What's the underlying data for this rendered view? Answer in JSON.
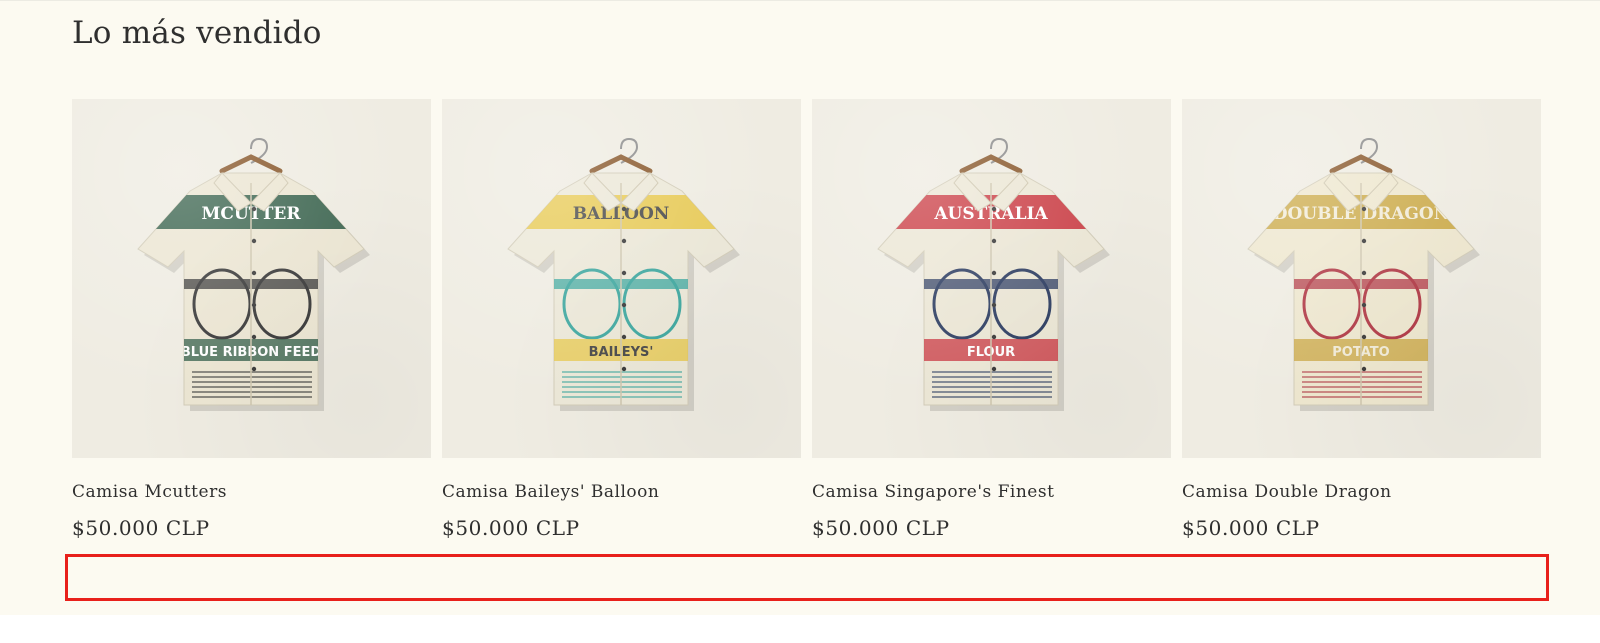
{
  "section": {
    "title": "Lo más vendido"
  },
  "products": [
    {
      "title": "Camisa Mcutters",
      "price": "$50.000 CLP",
      "image_label": "MCUTTER",
      "image_sub": "BLUE RIBBON FEED",
      "palette": {
        "base": "#ece6d3",
        "primary": "#2d5a45",
        "secondary": "#3a3a3a",
        "accent": "#ffffff"
      }
    },
    {
      "title": "Camisa Baileys' Balloon",
      "price": "$50.000 CLP",
      "image_label": "BALLOON",
      "image_sub": "BAILEYS'",
      "palette": {
        "base": "#ece8d8",
        "primary": "#e8c84a",
        "secondary": "#3fa8a0",
        "accent": "#4a4a4a"
      }
    },
    {
      "title": "Camisa Singapore's Finest",
      "price": "$50.000 CLP",
      "image_label": "AUSTRALIA",
      "image_sub": "FLOUR",
      "palette": {
        "base": "#ece7d6",
        "primary": "#c9323c",
        "secondary": "#2f3f63",
        "accent": "#ffffff"
      }
    },
    {
      "title": "Camisa Double Dragon",
      "price": "$50.000 CLP",
      "image_label": "DOUBLE DRAGON",
      "image_sub": "POTATO",
      "palette": {
        "base": "#eee7cf",
        "primary": "#c9a640",
        "secondary": "#b13a46",
        "accent": "#f2ecd9"
      }
    }
  ],
  "icons": {
    "hanger": "hanger-icon"
  }
}
